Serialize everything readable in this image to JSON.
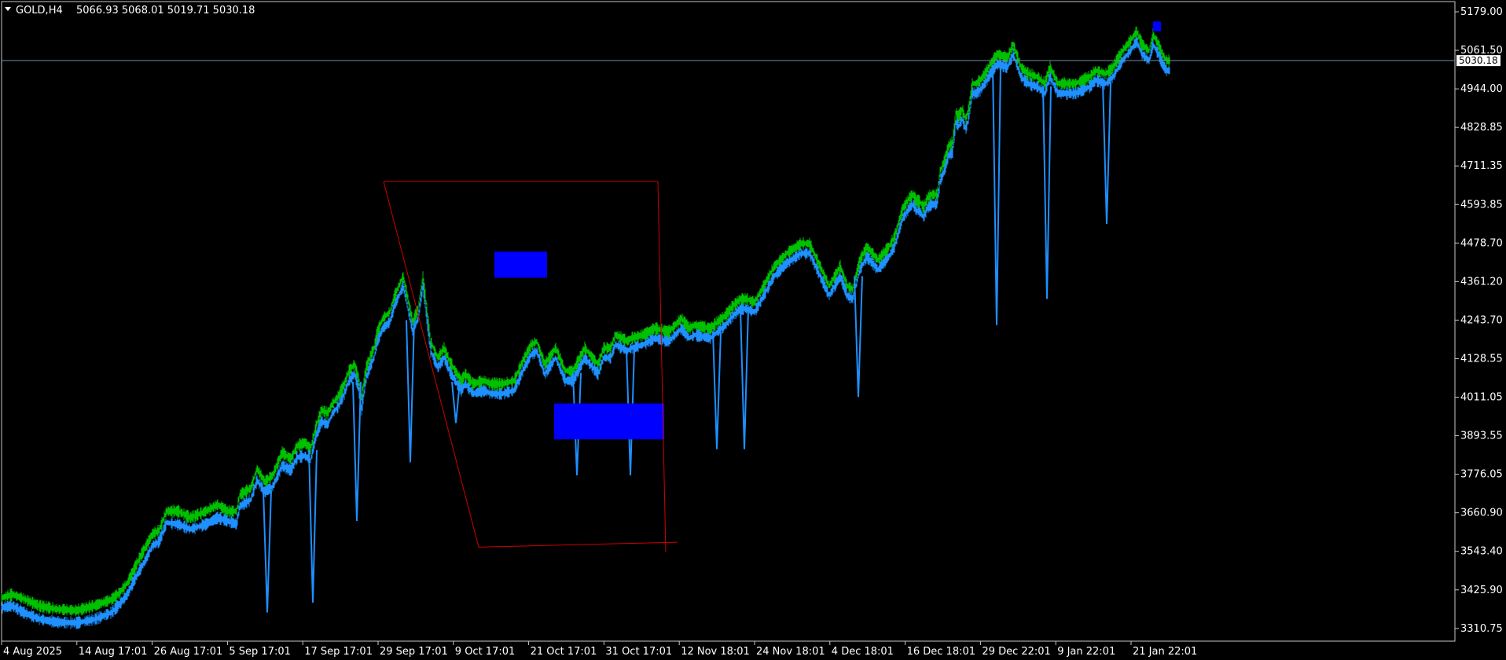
{
  "header": {
    "symbol": "GOLD,H4",
    "ohlc": "5066.93 5068.01 5019.71 5030.18"
  },
  "colors": {
    "background": "#000000",
    "frame": "#c8c8c8",
    "bull": "#00c000",
    "bear": "#1e90ff",
    "zone": "#0000ff",
    "trendline": "#d00000",
    "bid_line": "#6a90b0"
  },
  "chart_data": {
    "type": "line",
    "title": "",
    "instrument": "GOLD",
    "timeframe": "H4",
    "ylim": [
      3252,
      5211
    ],
    "price_ticks": [
      "5179.00",
      "5061.50",
      "4944.00",
      "4828.85",
      "4711.35",
      "4593.85",
      "4478.70",
      "4361.20",
      "4243.70",
      "4128.55",
      "4011.05",
      "3893.55",
      "3776.05",
      "3660.90",
      "3543.40",
      "3425.90",
      "3310.75"
    ],
    "time_ticks": [
      "4 Aug 2025",
      "14 Aug 17:01",
      "26 Aug 17:01",
      "5 Sep 17:01",
      "17 Sep 17:01",
      "29 Sep 17:01",
      "9 Oct 17:01",
      "21 Oct 17:01",
      "31 Oct 17:01",
      "12 Nov 18:01",
      "24 Nov 18:01",
      "4 Dec 18:01",
      "16 Dec 18:01",
      "29 Dec 22:01",
      "9 Jan 22:01",
      "21 Jan 22:01"
    ],
    "current_price": "5030.18",
    "series": [
      {
        "style": "green price band (bull)",
        "x_index": [
          0,
          14,
          28,
          48,
          70,
          96,
          120,
          140,
          150,
          160,
          170,
          183,
          192,
          200,
          210,
          225,
          240,
          260,
          275,
          288,
          299,
          303,
          317,
          325,
          335,
          345,
          357,
          368,
          376,
          386,
          393,
          400,
          407,
          415,
          421,
          428,
          436,
          442,
          449,
          454,
          458,
          464,
          470,
          474,
          478,
          485,
          494,
          500,
          511,
          523,
          530,
          536,
          546,
          555,
          563,
          570,
          577,
          585,
          590,
          600,
          614,
          623,
          630,
          637,
          652,
          665,
          674,
          681,
          691,
          705,
          717,
          727,
          742,
          759,
          766,
          775,
          781,
          790,
          796,
          801,
          816,
          831,
          849,
          865,
          875,
          882,
          902,
          911,
          921,
          931,
          940,
          948,
          958,
          965,
          983,
          999,
          1017,
          1028,
          1053,
          1067,
          1076,
          1083,
          1092,
          1101,
          1115,
          1129,
          1136,
          1142,
          1147,
          1150,
          1155,
          1160,
          1164,
          1168,
          1173,
          1178,
          1183,
          1190,
          1194,
          1199,
          1205,
          1210,
          1214,
          1218,
          1222,
          1227,
          1231,
          1235,
          1240,
          1245,
          1251,
          1258,
          1267,
          1280,
          1287,
          1297,
          1306,
          1318,
          1327,
          1334,
          1344,
          1357,
          1366,
          1375,
          1384,
          1392,
          1405,
          1414,
          1426,
          1436,
          1444,
          1451,
          1460,
          1465,
          1472,
          1477,
          1482,
          1487
        ],
        "values": [
          3385,
          3395,
          3382,
          3360,
          3350,
          3346,
          3362,
          3380,
          3400,
          3430,
          3480,
          3540,
          3580,
          3590,
          3650,
          3650,
          3630,
          3650,
          3670,
          3650,
          3650,
          3700,
          3720,
          3780,
          3740,
          3760,
          3830,
          3810,
          3850,
          3860,
          3840,
          3910,
          3960,
          3950,
          3980,
          4000,
          4040,
          4080,
          4100,
          4060,
          4000,
          4090,
          4130,
          4150,
          4200,
          4240,
          4260,
          4310,
          4370,
          4230,
          4270,
          4370,
          4170,
          4120,
          4150,
          4110,
          4080,
          4050,
          4070,
          4040,
          4050,
          4040,
          4040,
          4040,
          4050,
          4120,
          4160,
          4170,
          4100,
          4150,
          4080,
          4080,
          4150,
          4100,
          4150,
          4150,
          4190,
          4180,
          4170,
          4180,
          4190,
          4210,
          4200,
          4240,
          4210,
          4220,
          4210,
          4230,
          4250,
          4280,
          4300,
          4300,
          4290,
          4320,
          4400,
          4440,
          4470,
          4470,
          4340,
          4400,
          4340,
          4330,
          4420,
          4460,
          4420,
          4460,
          4490,
          4540,
          4580,
          4590,
          4610,
          4620,
          4600,
          4600,
          4580,
          4610,
          4620,
          4620,
          4690,
          4720,
          4770,
          4780,
          4870,
          4860,
          4880,
          4850,
          4890,
          4960,
          4960,
          4970,
          4990,
          5020,
          5050,
          5040,
          5080,
          5010,
          4990,
          4980,
          4960,
          5010,
          4960,
          4960,
          4960,
          4970,
          4980,
          5000,
          4990,
          5010,
          5060,
          5090,
          5120,
          5080,
          5060,
          5110,
          5080,
          5050,
          5030,
          5030
        ]
      },
      {
        "style": "blue price band (bear)",
        "x_index": [
          0,
          14,
          28,
          48,
          70,
          96,
          120,
          140,
          150,
          160,
          170,
          183,
          192,
          200,
          210,
          225,
          240,
          260,
          275,
          288,
          299,
          303,
          317,
          325,
          335,
          345,
          357,
          368,
          376,
          386,
          393,
          400,
          407,
          415,
          421,
          428,
          436,
          442,
          449,
          454,
          458,
          464,
          470,
          474,
          478,
          485,
          494,
          500,
          511,
          523,
          530,
          536,
          546,
          555,
          563,
          570,
          577,
          585,
          590,
          600,
          614,
          623,
          630,
          637,
          652,
          665,
          674,
          681,
          691,
          705,
          717,
          727,
          742,
          759,
          766,
          775,
          781,
          790,
          796,
          801,
          816,
          831,
          849,
          865,
          875,
          882,
          902,
          911,
          921,
          931,
          940,
          948,
          958,
          965,
          983,
          999,
          1017,
          1028,
          1053,
          1067,
          1076,
          1083,
          1092,
          1101,
          1115,
          1129,
          1136,
          1142,
          1147,
          1150,
          1155,
          1160,
          1164,
          1168,
          1173,
          1178,
          1183,
          1190,
          1194,
          1199,
          1205,
          1210,
          1214,
          1218,
          1222,
          1227,
          1231,
          1235,
          1240,
          1245,
          1251,
          1258,
          1267,
          1280,
          1287,
          1297,
          1306,
          1318,
          1327,
          1334,
          1344,
          1357,
          1366,
          1375,
          1384,
          1392,
          1405,
          1414,
          1426,
          1436,
          1444,
          1451,
          1460,
          1465,
          1472,
          1477,
          1482,
          1487
        ],
        "values": [
          3355,
          3360,
          3340,
          3320,
          3310,
          3308,
          3320,
          3340,
          3365,
          3395,
          3445,
          3500,
          3545,
          3555,
          3615,
          3610,
          3595,
          3610,
          3630,
          3620,
          3610,
          3665,
          3685,
          3745,
          3710,
          3725,
          3790,
          3775,
          3815,
          3820,
          3805,
          3880,
          3925,
          3915,
          3950,
          3970,
          4010,
          4050,
          4070,
          4030,
          3960,
          4060,
          4100,
          4120,
          4170,
          4210,
          4230,
          4280,
          4340,
          4200,
          4240,
          4340,
          4140,
          4090,
          4120,
          4080,
          4050,
          4020,
          4040,
          4010,
          4020,
          4010,
          4010,
          4010,
          4020,
          4090,
          4130,
          4140,
          4070,
          4120,
          4050,
          4050,
          4120,
          4070,
          4120,
          4120,
          4160,
          4150,
          4140,
          4150,
          4160,
          4180,
          4170,
          4210,
          4180,
          4190,
          4180,
          4200,
          4220,
          4250,
          4270,
          4270,
          4260,
          4290,
          4370,
          4410,
          4440,
          4440,
          4310,
          4370,
          4310,
          4300,
          4390,
          4430,
          4390,
          4430,
          4460,
          4510,
          4550,
          4560,
          4580,
          4590,
          4570,
          4570,
          4550,
          4580,
          4590,
          4590,
          4660,
          4690,
          4740,
          4750,
          4840,
          4830,
          4850,
          4820,
          4860,
          4930,
          4930,
          4940,
          4960,
          4990,
          5020,
          5010,
          5050,
          4980,
          4960,
          4950,
          4930,
          4980,
          4930,
          4930,
          4930,
          4940,
          4950,
          4970,
          4960,
          4980,
          5030,
          5060,
          5090,
          5050,
          5030,
          5080,
          5050,
          5020,
          5000,
          5000
        ]
      }
    ],
    "spikes_low": [
      {
        "x_index": 338,
        "value": 3340
      },
      {
        "x_index": 396,
        "value": 3370
      },
      {
        "x_index": 452,
        "value": 3620
      },
      {
        "x_index": 520,
        "value": 3800
      },
      {
        "x_index": 578,
        "value": 3920
      },
      {
        "x_index": 732,
        "value": 3760
      },
      {
        "x_index": 800,
        "value": 3760
      },
      {
        "x_index": 910,
        "value": 3840
      },
      {
        "x_index": 945,
        "value": 3840
      },
      {
        "x_index": 1090,
        "value": 4000
      },
      {
        "x_index": 1266,
        "value": 4220
      },
      {
        "x_index": 1330,
        "value": 4300
      },
      {
        "x_index": 1406,
        "value": 4530
      }
    ],
    "zones": [
      {
        "x_from": 627,
        "x_to": 694,
        "price_from": 4365,
        "price_to": 4445
      },
      {
        "x_from": 703,
        "x_to": 843,
        "price_from": 3870,
        "price_to": 3980
      },
      {
        "x_from": 1465,
        "x_to": 1475,
        "price_from": 5120,
        "price_to": 5150
      }
    ],
    "trendlines": [
      {
        "x1": 486,
        "y1": 4660,
        "x2": 607,
        "y2": 3540
      },
      {
        "x1": 486,
        "y1": 4660,
        "x2": 835,
        "y2": 4660
      },
      {
        "x1": 835,
        "y1": 4660,
        "x2": 845,
        "y2": 3525
      },
      {
        "x1": 607,
        "y1": 3540,
        "x2": 860,
        "y2": 3555
      }
    ]
  }
}
